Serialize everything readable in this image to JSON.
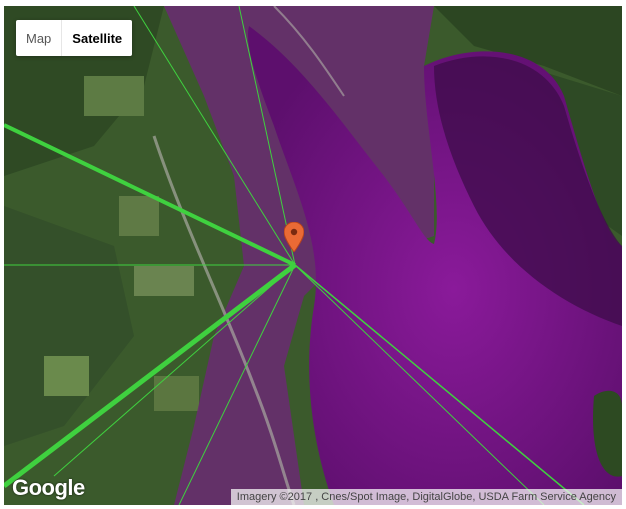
{
  "map_type_control": {
    "map_label": "Map",
    "satellite_label": "Satellite",
    "selected": "Satellite"
  },
  "logo": {
    "text": "Google"
  },
  "attribution": {
    "text": "Imagery ©2017 , Cnes/Spot Image, DigitalGlobe, USDA Farm Service Agency"
  },
  "marker": {
    "icon": "map-pin-icon",
    "color": "#ea6a35"
  },
  "overlay": {
    "lake_tint_color": "#8a1a9a",
    "line_color": "#3fd13f"
  }
}
